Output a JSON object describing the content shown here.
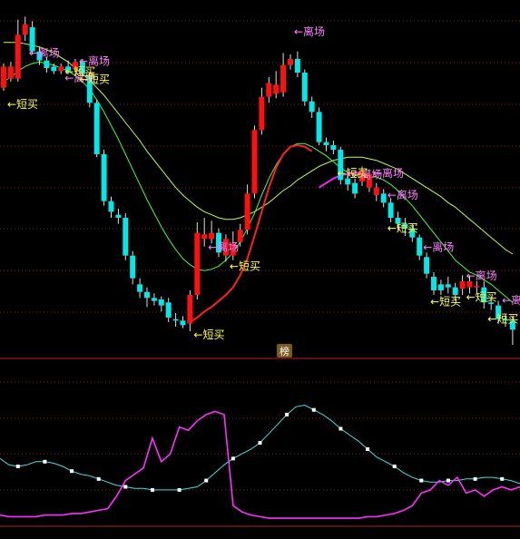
{
  "chart_data": [
    {
      "type": "candlestick",
      "panel": "main",
      "grid": true,
      "candles": [
        {
          "o": 2.8,
          "c": 4.2,
          "h": 4.4,
          "l": 2.6,
          "col": "red"
        },
        {
          "o": 4.2,
          "c": 3.4,
          "h": 4.5,
          "l": 3.2,
          "col": "red"
        },
        {
          "o": 3.4,
          "c": 6.3,
          "h": 7.3,
          "l": 3.2,
          "col": "red"
        },
        {
          "o": 6.3,
          "c": 7.0,
          "h": 7.5,
          "l": 5.9,
          "col": "red"
        },
        {
          "o": 6.8,
          "c": 5.2,
          "h": 7.2,
          "l": 5.0,
          "col": "cyan"
        },
        {
          "o": 5.2,
          "c": 4.6,
          "h": 5.5,
          "l": 4.3,
          "col": "cyan"
        },
        {
          "o": 4.6,
          "c": 4.1,
          "h": 4.8,
          "l": 3.8,
          "col": "cyan"
        },
        {
          "o": 4.2,
          "c": 3.9,
          "h": 4.4,
          "l": 3.7,
          "col": "cyan"
        },
        {
          "o": 3.9,
          "c": 4.2,
          "h": 4.4,
          "l": 3.7,
          "col": "red"
        },
        {
          "o": 4.2,
          "c": 3.9,
          "h": 4.6,
          "l": 3.7,
          "col": "cyan"
        },
        {
          "o": 4.0,
          "c": 4.5,
          "h": 4.7,
          "l": 3.8,
          "col": "red"
        },
        {
          "o": 4.5,
          "c": 3.7,
          "h": 4.7,
          "l": 3.6,
          "col": "cyan"
        },
        {
          "o": 3.6,
          "c": 1.8,
          "h": 3.8,
          "l": 1.5,
          "col": "cyan"
        },
        {
          "o": 1.8,
          "c": -1.6,
          "h": 2.0,
          "l": -1.8,
          "col": "cyan"
        },
        {
          "o": -1.6,
          "c": -4.7,
          "h": -1.3,
          "l": -5.0,
          "col": "cyan"
        },
        {
          "o": -4.7,
          "c": -5.4,
          "h": -4.4,
          "l": -5.8,
          "col": "cyan"
        },
        {
          "o": -5.6,
          "c": -5.8,
          "h": -5.2,
          "l": -6.2,
          "col": "cyan"
        },
        {
          "o": -5.8,
          "c": -8.3,
          "h": -5.5,
          "l": -8.6,
          "col": "cyan"
        },
        {
          "o": -8.3,
          "c": -9.8,
          "h": -8.0,
          "l": -10.2,
          "col": "cyan"
        },
        {
          "o": -10.2,
          "c": -10.7,
          "h": -9.8,
          "l": -11.1,
          "col": "cyan"
        },
        {
          "o": -10.7,
          "c": -11.1,
          "h": -10.4,
          "l": -11.7,
          "col": "cyan"
        },
        {
          "o": -11.1,
          "c": -11.3,
          "h": -10.8,
          "l": -11.6,
          "col": "cyan"
        },
        {
          "o": -11.2,
          "c": -11.6,
          "h": -11.0,
          "l": -12.0,
          "col": "cyan"
        },
        {
          "o": -11.4,
          "c": -12.4,
          "h": -11.1,
          "l": -12.7,
          "col": "cyan"
        },
        {
          "o": -12.5,
          "c": -12.6,
          "h": -12.1,
          "l": -13.0,
          "col": "cyan"
        },
        {
          "o": -12.6,
          "c": -12.9,
          "h": -12.3,
          "l": -13.1,
          "col": "cyan"
        },
        {
          "o": -12.8,
          "c": -10.9,
          "h": -10.6,
          "l": -13.3,
          "col": "red"
        },
        {
          "o": -10.9,
          "c": -6.8,
          "h": -6.1,
          "l": -11.2,
          "col": "red"
        },
        {
          "o": -6.9,
          "c": -7.2,
          "h": -5.8,
          "l": -7.7,
          "col": "red"
        },
        {
          "o": -7.2,
          "c": -6.8,
          "h": -6.0,
          "l": -7.5,
          "col": "red"
        },
        {
          "o": -6.8,
          "c": -8.1,
          "h": -6.5,
          "l": -8.4,
          "col": "cyan"
        },
        {
          "o": -7.2,
          "c": -8.3,
          "h": -6.9,
          "l": -8.7,
          "col": "red"
        },
        {
          "o": -8.3,
          "c": -7.5,
          "h": -6.7,
          "l": -8.6,
          "col": "red"
        },
        {
          "o": -7.4,
          "c": -6.6,
          "h": -6.2,
          "l": -7.7,
          "col": "red"
        },
        {
          "o": -6.6,
          "c": -4.2,
          "h": -3.6,
          "l": -6.9,
          "col": "red"
        },
        {
          "o": -4.2,
          "c": 0.0,
          "h": 0.3,
          "l": -4.5,
          "col": "red"
        },
        {
          "o": 0.0,
          "c": 2.2,
          "h": 2.8,
          "l": -0.3,
          "col": "red"
        },
        {
          "o": 2.2,
          "c": 3.1,
          "h": 3.5,
          "l": 1.8,
          "col": "red"
        },
        {
          "o": 3.0,
          "c": 2.4,
          "h": 3.9,
          "l": 2.1,
          "col": "red"
        },
        {
          "o": 2.5,
          "c": 4.3,
          "h": 5.1,
          "l": 2.2,
          "col": "red"
        },
        {
          "o": 4.3,
          "c": 4.7,
          "h": 5.0,
          "l": 4.0,
          "col": "red"
        },
        {
          "o": 4.7,
          "c": 3.8,
          "h": 5.2,
          "l": 3.5,
          "col": "cyan"
        },
        {
          "o": 3.8,
          "c": 1.9,
          "h": 4.0,
          "l": 1.6,
          "col": "cyan"
        },
        {
          "o": 1.9,
          "c": 1.2,
          "h": 2.2,
          "l": 0.8,
          "col": "cyan"
        },
        {
          "o": 1.2,
          "c": -0.8,
          "h": 1.5,
          "l": -1.0,
          "col": "cyan"
        },
        {
          "o": -0.8,
          "c": -1.0,
          "h": -0.5,
          "l": -1.4,
          "col": "cyan"
        },
        {
          "o": -1.0,
          "c": -1.3,
          "h": -0.7,
          "l": -1.6,
          "col": "cyan"
        },
        {
          "o": -1.3,
          "c": -3.3,
          "h": -1.1,
          "l": -3.6,
          "col": "cyan"
        },
        {
          "o": -3.2,
          "c": -3.6,
          "h": -2.9,
          "l": -4.0,
          "col": "cyan"
        },
        {
          "o": -3.5,
          "c": -4.2,
          "h": -3.2,
          "l": -4.5,
          "col": "cyan"
        },
        {
          "o": -3.4,
          "c": -2.7,
          "h": -2.4,
          "l": -3.7,
          "col": "red"
        },
        {
          "o": -2.9,
          "c": -3.8,
          "h": -2.6,
          "l": -4.1,
          "col": "red"
        },
        {
          "o": -3.8,
          "c": -4.3,
          "h": -3.5,
          "l": -4.7,
          "col": "red"
        },
        {
          "o": -4.2,
          "c": -4.8,
          "h": -3.9,
          "l": -5.1,
          "col": "cyan"
        },
        {
          "o": -4.8,
          "c": -5.8,
          "h": -4.5,
          "l": -6.1,
          "col": "cyan"
        },
        {
          "o": -5.8,
          "c": -6.2,
          "h": -5.4,
          "l": -6.6,
          "col": "cyan"
        },
        {
          "o": -6.2,
          "c": -6.5,
          "h": -5.8,
          "l": -7.0,
          "col": "cyan"
        },
        {
          "o": -6.5,
          "c": -7.1,
          "h": -6.2,
          "l": -7.4,
          "col": "cyan"
        },
        {
          "o": -7.1,
          "c": -8.3,
          "h": -6.9,
          "l": -8.6,
          "col": "cyan"
        },
        {
          "o": -8.4,
          "c": -9.5,
          "h": -8.1,
          "l": -9.8,
          "col": "cyan"
        },
        {
          "o": -9.7,
          "c": -10.6,
          "h": -9.4,
          "l": -10.9,
          "col": "cyan"
        },
        {
          "o": -10.6,
          "c": -10.2,
          "h": -9.9,
          "l": -10.9,
          "col": "cyan"
        },
        {
          "o": -10.2,
          "c": -10.4,
          "h": -9.7,
          "l": -10.8,
          "col": "cyan"
        },
        {
          "o": -10.4,
          "c": -10.9,
          "h": -10.1,
          "l": -11.3,
          "col": "cyan"
        },
        {
          "o": -10.5,
          "c": -10.0,
          "h": -9.6,
          "l": -10.9,
          "col": "red"
        },
        {
          "o": -10.0,
          "c": -10.4,
          "h": -9.6,
          "l": -10.8,
          "col": "red"
        },
        {
          "o": -10.4,
          "c": -10.3,
          "h": -10.0,
          "l": -10.7,
          "col": "red"
        },
        {
          "o": -10.4,
          "c": -11.4,
          "h": -10.0,
          "l": -11.8,
          "col": "cyan"
        },
        {
          "o": -11.4,
          "c": -11.5,
          "h": -11.0,
          "l": -11.9,
          "col": "cyan"
        },
        {
          "o": -11.6,
          "c": -12.5,
          "h": -11.3,
          "l": -12.8,
          "col": "cyan"
        },
        {
          "o": -12.5,
          "c": -12.6,
          "h": -12.2,
          "l": -13.0,
          "col": "cyan"
        },
        {
          "o": -12.6,
          "c": -13.2,
          "h": -12.3,
          "l": -14.2,
          "col": "cyan"
        }
      ],
      "ma_short": [
        3.2,
        3.5,
        3.9,
        4.2,
        4.4,
        4.5,
        4.4,
        4.3,
        4.1,
        3.9,
        3.6,
        3.2,
        2.7,
        2.0,
        1.2,
        0.3,
        -0.6,
        -1.6,
        -2.6,
        -3.6,
        -4.6,
        -5.5,
        -6.4,
        -7.2,
        -7.9,
        -8.5,
        -8.9,
        -9.2,
        -9.3,
        -9.2,
        -9.0,
        -8.6,
        -8.1,
        -7.4,
        -6.5,
        -5.5,
        -4.3,
        -3.2,
        -2.3,
        -1.6,
        -1.1,
        -0.9,
        -0.9,
        -1.1,
        -1.4,
        -1.7,
        -2.1,
        -2.5,
        -2.8,
        -3.0,
        -3.1,
        -3.1,
        -3.1,
        -3.3,
        -3.6,
        -4.0,
        -4.5,
        -5.0,
        -5.6,
        -6.2,
        -6.8,
        -7.4,
        -8.0,
        -8.6,
        -9.0,
        -9.4,
        -9.6,
        -9.9,
        -10.2,
        -10.6,
        -11.0,
        -11.4
      ],
      "ma_long": [
        5.8,
        5.8,
        5.8,
        5.7,
        5.6,
        5.5,
        5.3,
        5.1,
        4.8,
        4.5,
        4.1,
        3.7,
        3.3,
        2.8,
        2.3,
        1.7,
        1.1,
        0.5,
        -0.1,
        -0.7,
        -1.4,
        -2.0,
        -2.6,
        -3.2,
        -3.8,
        -4.3,
        -4.7,
        -5.1,
        -5.4,
        -5.6,
        -5.8,
        -5.9,
        -5.9,
        -5.8,
        -5.6,
        -5.4,
        -5.1,
        -4.8,
        -4.4,
        -4.0,
        -3.7,
        -3.3,
        -3.0,
        -2.7,
        -2.4,
        -2.2,
        -2.0,
        -1.9,
        -1.8,
        -1.8,
        -1.8,
        -1.9,
        -2.0,
        -2.2,
        -2.4,
        -2.6,
        -2.9,
        -3.2,
        -3.5,
        -3.8,
        -4.1,
        -4.4,
        -4.8,
        -5.1,
        -5.5,
        -5.9,
        -6.3,
        -6.7,
        -7.1,
        -7.5,
        -7.9,
        -8.2
      ],
      "ma_mid_red": {
        "start": 26,
        "values": [
          -12.7,
          -12.4,
          -12.0,
          -11.7,
          -11.3,
          -10.9,
          -10.4,
          -9.6,
          -8.5,
          -7.0,
          -5.4,
          -3.8,
          -2.5,
          -1.6,
          -1.1,
          -1.0,
          -1.1,
          -1.4
        ]
      },
      "ma_mid_magenta": {
        "start": 44,
        "values": [
          -3.8,
          -3.5,
          -3.2,
          -3.0,
          -2.9,
          -2.8,
          -2.9,
          -3.0
        ]
      },
      "ylim": [
        -14.5,
        8.0
      ],
      "annotations": [
        {
          "i": 3,
          "dy": -1.6,
          "text": "←离场",
          "color": "#ff80ff"
        },
        {
          "i": 8,
          "dy": -0.6,
          "text": "←离场",
          "color": "#ff80ff"
        },
        {
          "i": 10,
          "dy": 0.3,
          "text": "←离场",
          "color": "#ff80ff"
        },
        {
          "i": 0,
          "dy": -1.8,
          "text": "←短买",
          "color": "#ffff40"
        },
        {
          "i": 8,
          "dy": -0.2,
          "text": "←短买",
          "color": "#ffff40"
        },
        {
          "i": 10,
          "dy": -0.9,
          "text": "←短买",
          "color": "#ffff40"
        },
        {
          "i": 28,
          "dy": -1.0,
          "text": "←离场",
          "color": "#ff80ff"
        },
        {
          "i": 26,
          "dy": -1.6,
          "text": "←短买",
          "color": "#ffff40"
        },
        {
          "i": 31,
          "dy": -1.2,
          "text": "←短买",
          "color": "#ffff40"
        },
        {
          "i": 40,
          "dy": 2.0,
          "text": "←离场",
          "color": "#ff80ff"
        },
        {
          "i": 48,
          "dy": 0.5,
          "text": "←离场",
          "color": "#ff80ff"
        },
        {
          "i": 51,
          "dy": 0.5,
          "text": "←离场",
          "color": "#ff80ff"
        },
        {
          "i": 53,
          "dy": 0.2,
          "text": "←离场",
          "color": "#ff80ff"
        },
        {
          "i": 58,
          "dy": 0.0,
          "text": "←离场",
          "color": "#ff80ff"
        },
        {
          "i": 46,
          "dy": -1.7,
          "text": "←短买",
          "color": "#ffff40"
        },
        {
          "i": 53,
          "dy": -2.0,
          "text": "←短买",
          "color": "#ffff40"
        },
        {
          "i": 59,
          "dy": -2.4,
          "text": "←短买",
          "color": "#ffff40"
        },
        {
          "i": 64,
          "dy": 0.6,
          "text": "←离场",
          "color": "#ff80ff"
        },
        {
          "i": 69,
          "dy": 0.8,
          "text": "←离场",
          "color": "#ff80ff"
        },
        {
          "i": 64,
          "dy": -0.8,
          "text": "←短买",
          "color": "#ffff40"
        },
        {
          "i": 67,
          "dy": -1.6,
          "text": "←短买",
          "color": "#ffff40"
        }
      ]
    },
    {
      "type": "line",
      "panel": "indicator",
      "label": "榜",
      "ylim": [
        0,
        100
      ],
      "series": [
        {
          "color": "#40e0e0",
          "marker_every": 3,
          "values": [
            42,
            38,
            37,
            38,
            40,
            40,
            39,
            37,
            34,
            32,
            31,
            29,
            27,
            25,
            24,
            23,
            23,
            22,
            22,
            22,
            22,
            23,
            24,
            28,
            33,
            38,
            42,
            45,
            48,
            52,
            58,
            64,
            70,
            75,
            76,
            73,
            70,
            66,
            61,
            57,
            53,
            48,
            43,
            40,
            37,
            33,
            30,
            28,
            27,
            27,
            28,
            28,
            29,
            29,
            30,
            30,
            29,
            28,
            26
          ]
        },
        {
          "color": "#ff30ff",
          "values": [
            6,
            5,
            5,
            5,
            5,
            6,
            6,
            6,
            7,
            7,
            8,
            9,
            10,
            18,
            28,
            32,
            36,
            55,
            40,
            45,
            62,
            60,
            66,
            70,
            72,
            70,
            12,
            8,
            6,
            5,
            4,
            4,
            4,
            4,
            4,
            4,
            4,
            4,
            4,
            4,
            4,
            5,
            5,
            6,
            7,
            9,
            12,
            20,
            22,
            28,
            25,
            30,
            20,
            22,
            18,
            22,
            24,
            22,
            24
          ]
        }
      ]
    }
  ]
}
